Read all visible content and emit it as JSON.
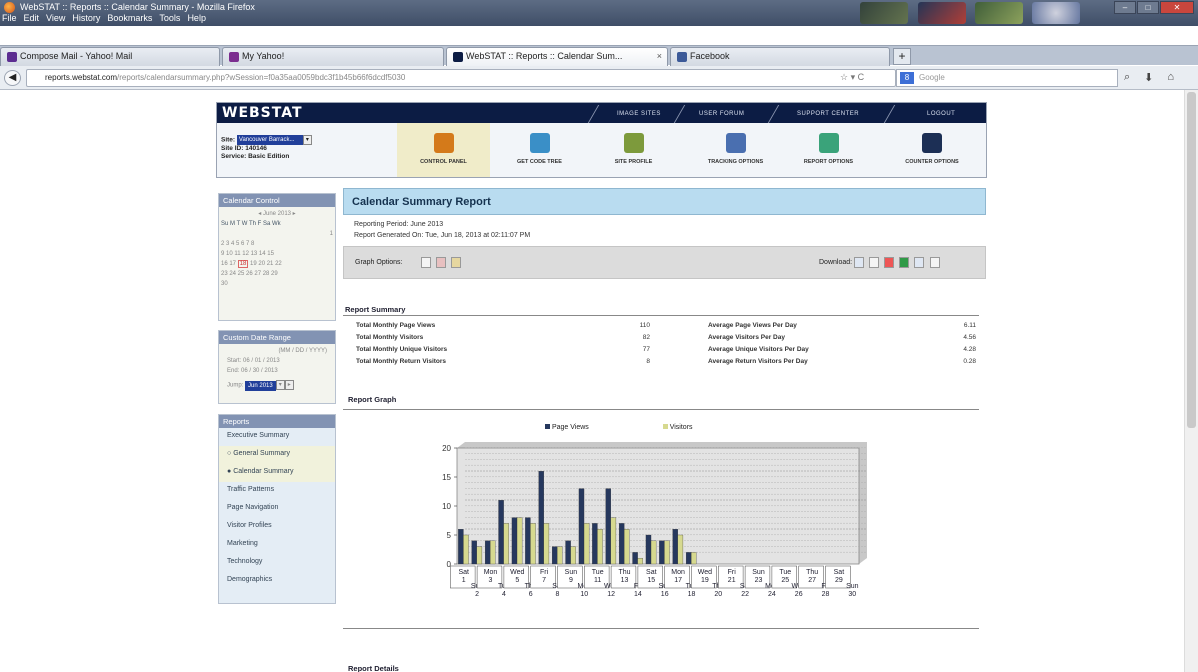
{
  "window": {
    "title": "WebSTAT :: Reports :: Calendar Summary - Mozilla Firefox",
    "buttons": [
      "–",
      "□",
      "✕"
    ]
  },
  "menu": [
    "File",
    "Edit",
    "View",
    "History",
    "Bookmarks",
    "Tools",
    "Help"
  ],
  "tabs": [
    {
      "label": "Compose Mail - Yahoo! Mail",
      "color": "#5c2d91"
    },
    {
      "label": "My Yahoo!",
      "color": "#7b2d8f"
    },
    {
      "label": "WebSTAT :: Reports :: Calendar Sum...",
      "color": "#0c1c44"
    },
    {
      "label": "Facebook",
      "color": "#3b5998"
    }
  ],
  "nav": {
    "url_domain": "reports.webstat.com",
    "url_rest": "/reports/calendarsummary.php?wSession=f0a35aa0059bdc3f1b45b66f6dcdf5030",
    "search_placeholder": "Google"
  },
  "webstat": {
    "logo": "WEBSTAT",
    "top_nav": [
      "IMAGE SITES",
      "USER FORUM",
      "SUPPORT CENTER",
      "LOGOUT"
    ],
    "site_label": "Site:",
    "site_value": "Vancouver Barrack...",
    "site_id_label": "Site ID:",
    "site_id": "140146",
    "service_label": "Service:",
    "service": "Basic Edition",
    "tools": [
      {
        "label": "CONTROL PANEL",
        "color": "#d47a1a"
      },
      {
        "label": "GET CODE TREE",
        "color": "#3a8fc7"
      },
      {
        "label": "SITE PROFILE",
        "color": "#7d9a3c"
      },
      {
        "label": "TRACKING OPTIONS",
        "color": "#4a6fb0"
      },
      {
        "label": "REPORT OPTIONS",
        "color": "#3aa37a"
      },
      {
        "label": "COUNTER OPTIONS",
        "color": "#1c2f55"
      }
    ]
  },
  "left": {
    "calendar_head": "Calendar Control",
    "calendar_month": "June 2013",
    "calendar_days": "Su M T W Th F Sa Wk",
    "calendar_rows": [
      "                    1",
      "2 3 4 5 6 7 8  ",
      "9 10 11 12 13 14 15",
      "16 17 18 19 20 21 22",
      "23 24 25 26 27 28 29",
      "30"
    ],
    "calendar_today": "18",
    "range_head": "Custom Date Range",
    "range_format": "(MM / DD / YYYY)",
    "range_start_label": "Start:",
    "range_start": "06 / 01 / 2013",
    "range_end_label": "End:",
    "range_end": "06 / 30 / 2013",
    "jump_label": "Jump:",
    "jump_value": "Jun 2013",
    "reports_head": "Reports",
    "reports": [
      "Executive Summary",
      "General Summary",
      "Calendar Summary",
      "Traffic Patterns",
      "Page Navigation",
      "Visitor Profiles",
      "Marketing",
      "Technology",
      "Demographics"
    ]
  },
  "report": {
    "title": "Calendar Summary Report",
    "period": "Reporting Period: June 2013",
    "generated": "Report Generated On: Tue, Jun 18, 2013 at 02:11:07 PM",
    "graph_options": "Graph Options:",
    "download": "Download:",
    "summary_title": "Report Summary",
    "summary_left": [
      {
        "label": "Total Monthly Page Views",
        "value": "110"
      },
      {
        "label": "Total Monthly Visitors",
        "value": "82"
      },
      {
        "label": "Total Monthly Unique Visitors",
        "value": "77"
      },
      {
        "label": "Total Monthly Return Visitors",
        "value": "8"
      }
    ],
    "summary_right": [
      {
        "label": "Average Page Views Per Day",
        "value": "6.11"
      },
      {
        "label": "Average Visitors Per Day",
        "value": "4.56"
      },
      {
        "label": "Average Unique Visitors Per Day",
        "value": "4.28"
      },
      {
        "label": "Average Return Visitors Per Day",
        "value": "0.28"
      }
    ],
    "graph_title": "Report Graph",
    "details_title": "Report Details"
  },
  "chart_data": {
    "type": "bar",
    "series": [
      {
        "name": "Page Views",
        "color": "#26385e",
        "values": [
          6,
          4,
          4,
          11,
          8,
          8,
          16,
          3,
          4,
          13,
          7,
          13,
          7,
          2,
          5,
          4,
          6,
          2,
          0,
          0,
          0,
          0,
          0,
          0,
          0,
          0,
          0,
          0,
          0,
          0
        ]
      },
      {
        "name": "Visitors",
        "color": "#d6d98f",
        "values": [
          5,
          3,
          4,
          7,
          8,
          7,
          7,
          3,
          3,
          7,
          6,
          8,
          6,
          1,
          4,
          4,
          5,
          2,
          0,
          0,
          0,
          0,
          0,
          0,
          0,
          0,
          0,
          0,
          0,
          0
        ]
      }
    ],
    "categories": [
      "Sat 1",
      "Sun 2",
      "Mon 3",
      "Tue 4",
      "Wed 5",
      "Thu 6",
      "Fri 7",
      "Sat 8",
      "Sun 9",
      "Mon 10",
      "Tue 11",
      "Wed 12",
      "Thu 13",
      "Fri 14",
      "Sat 15",
      "Sun 16",
      "Mon 17",
      "Tue 18",
      "Wed 19",
      "Thu 20",
      "Fri 21",
      "Sat 22",
      "Sun 23",
      "Mon 24",
      "Tue 25",
      "Wed 26",
      "Thu 27",
      "Fri 28",
      "Sat 29",
      "Sun 30"
    ],
    "day_names": [
      "Sat",
      "Sun",
      "Mon",
      "Tue",
      "Wed",
      "Thu",
      "Fri",
      "Sat",
      "Sun",
      "Mon",
      "Tue",
      "Wed",
      "Thu",
      "Fri",
      "Sat",
      "Sun",
      "Mon",
      "Tue",
      "Wed",
      "Thu",
      "Fri",
      "Sat",
      "Sun",
      "Mon",
      "Tue",
      "Wed",
      "Thu",
      "Fri",
      "Sat",
      "Sun"
    ],
    "day_nums": [
      "1",
      "2",
      "3",
      "4",
      "5",
      "6",
      "7",
      "8",
      "9",
      "10",
      "11",
      "12",
      "13",
      "14",
      "15",
      "16",
      "17",
      "18",
      "19",
      "20",
      "21",
      "22",
      "23",
      "24",
      "25",
      "26",
      "27",
      "28",
      "29",
      "30"
    ],
    "yticks": [
      "0",
      "5",
      "10",
      "15",
      "20"
    ],
    "ylim": [
      0,
      20
    ],
    "legend": [
      "Page Views",
      "Visitors"
    ],
    "grid": true
  }
}
